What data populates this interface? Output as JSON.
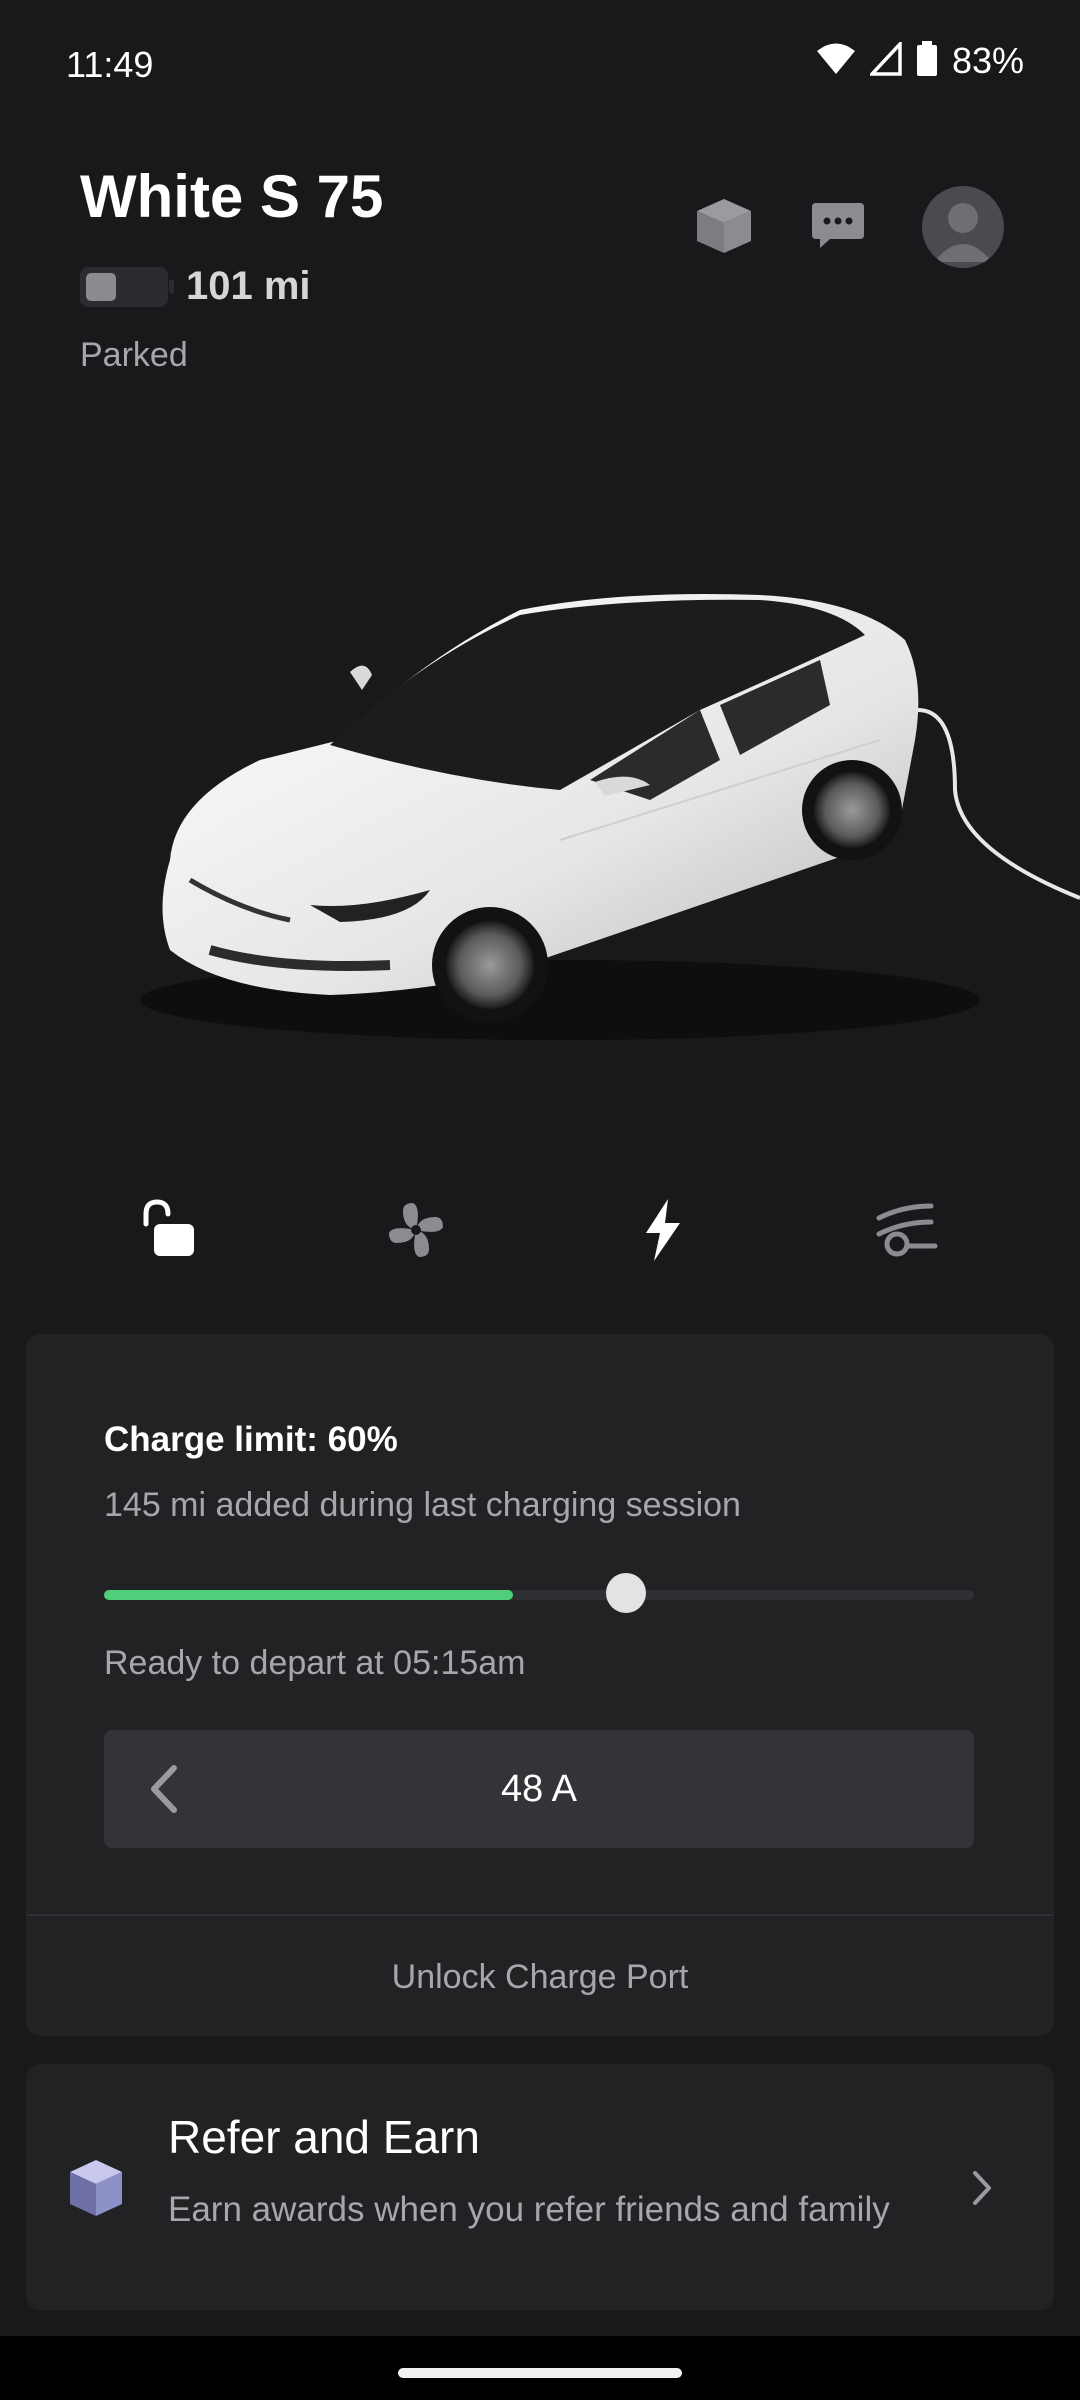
{
  "status_bar": {
    "time": "11:49",
    "battery_percent": "83%",
    "icons": [
      "wifi-icon",
      "cell-signal-icon",
      "battery-icon"
    ]
  },
  "vehicle": {
    "name": "White S 75",
    "range": "101 mi",
    "battery_level": 0.4,
    "status": "Parked"
  },
  "header_icons": [
    "cube-icon",
    "chat-icon",
    "avatar-icon"
  ],
  "quick_controls": [
    {
      "name": "lock-icon",
      "label": "Lock"
    },
    {
      "name": "fan-icon",
      "label": "Climate"
    },
    {
      "name": "charge-icon",
      "label": "Charge"
    },
    {
      "name": "summon-icon",
      "label": "Summon"
    }
  ],
  "charging": {
    "title": "Charge limit: 60%",
    "subtitle": "145 mi added during last charging session",
    "current_charge_fraction": 0.47,
    "limit_fraction": 0.6,
    "depart_text": "Ready to depart at 05:15am",
    "amperage": "48 A",
    "unlock_port_label": "Unlock Charge Port",
    "accent_color": "#4fcf7a"
  },
  "refer": {
    "title": "Refer and Earn",
    "description": "Earn awards when you refer friends and family"
  }
}
